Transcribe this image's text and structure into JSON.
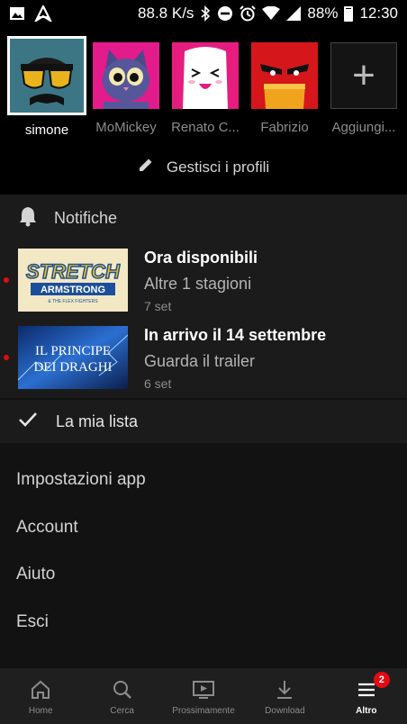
{
  "status_bar": {
    "speed": "88.8 K/s",
    "battery": "88%",
    "time": "12:30",
    "left_icons": [
      "image-icon",
      "navigation-icon"
    ],
    "right_icons": [
      "bluetooth-icon",
      "dnd-icon",
      "alarm-icon",
      "wifi-icon",
      "signal-icon",
      "battery-icon"
    ]
  },
  "profiles": {
    "items": [
      {
        "name": "simone",
        "selected": true,
        "color": "#3c6e7a"
      },
      {
        "name": "MoMickey",
        "selected": false,
        "color": "#e31b8b"
      },
      {
        "name": "Renato C...",
        "selected": false,
        "color": "#e61c7f"
      },
      {
        "name": "Fabrizio",
        "selected": false,
        "color": "#d5161b"
      },
      {
        "name": "Aggiungi...",
        "selected": false,
        "color": "#141414"
      }
    ],
    "add_symbol": "+",
    "manage_label": "Gestisci i profili"
  },
  "notifications": {
    "header": "Notifiche",
    "items": [
      {
        "title": "Ora disponibili",
        "subtitle": "Altre 1 stagioni",
        "date": "7 set",
        "thumb_text_1": "STRETCH",
        "thumb_text_2": "ARMSTRONG",
        "thumb_text_3": "& THE FLEX FIGHTERS"
      },
      {
        "title": "In arrivo il 14 settembre",
        "subtitle": "Guarda il trailer",
        "date": "6 set",
        "thumb_text_1": "IL PRINCIPE",
        "thumb_text_2": "DEI DRAGHI"
      }
    ]
  },
  "my_list": {
    "label": "La mia lista"
  },
  "menu": {
    "items": [
      "Impostazioni app",
      "Account",
      "Aiuto",
      "Esci"
    ]
  },
  "bottom_nav": {
    "items": [
      {
        "label": "Home",
        "icon": "home-icon"
      },
      {
        "label": "Cerca",
        "icon": "search-icon"
      },
      {
        "label": "Prossimamente",
        "icon": "coming-soon-icon"
      },
      {
        "label": "Download",
        "icon": "download-icon"
      },
      {
        "label": "Altro",
        "icon": "menu-icon",
        "active": true,
        "badge": "2"
      }
    ]
  },
  "colors": {
    "accent": "#e50914",
    "background": "#121212"
  }
}
